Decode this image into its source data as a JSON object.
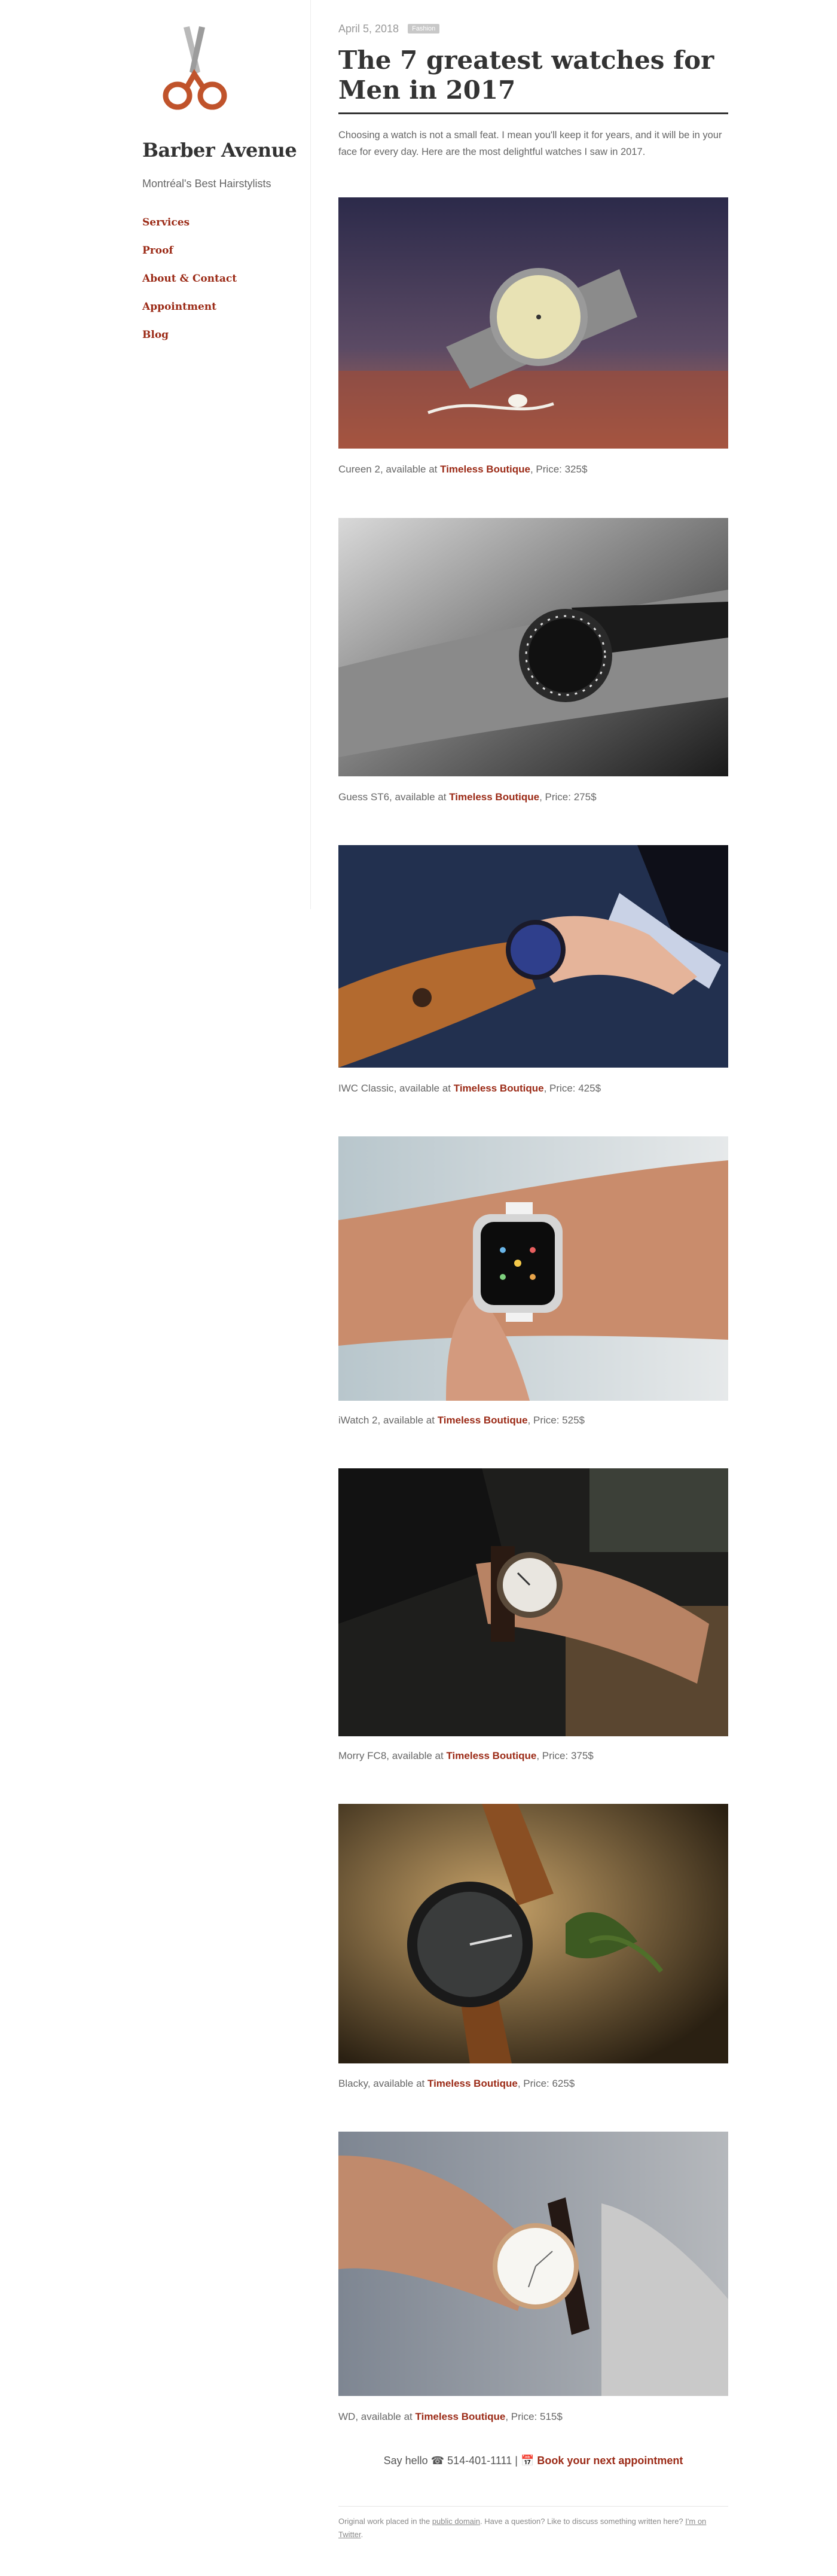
{
  "site": {
    "title": "Barber Avenue",
    "tagline": "Montréal's Best Hairstylists",
    "logo_icon": "scissors-icon",
    "accent": "#9b2a16"
  },
  "nav": [
    {
      "label": "Services"
    },
    {
      "label": "Proof"
    },
    {
      "label": "About & Contact"
    },
    {
      "label": "Appointment"
    },
    {
      "label": "Blog"
    }
  ],
  "post": {
    "date": "April 5, 2018",
    "tag": "Fashion",
    "title": "The 7 greatest watches for Men in 2017",
    "intro": "Choosing a watch is not a small feat. I mean you'll keep it for years, and it will be in your face for every day. Here are the most delightful watches I saw in 2017."
  },
  "items": [
    {
      "name": "Cureen 2",
      "shop": "Timeless Boutique",
      "price": "325$",
      "image": "watch-photo-cureen"
    },
    {
      "name": "Guess ST6",
      "shop": "Timeless Boutique",
      "price": "275$",
      "image": "watch-photo-guess"
    },
    {
      "name": "IWC Classic",
      "shop": "Timeless Boutique",
      "price": "425$",
      "image": "watch-photo-iwc"
    },
    {
      "name": "iWatch 2",
      "shop": "Timeless Boutique",
      "price": "525$",
      "image": "watch-photo-iwatch"
    },
    {
      "name": "Morry FC8",
      "shop": "Timeless Boutique",
      "price": "375$",
      "image": "watch-photo-morry"
    },
    {
      "name": "Blacky",
      "shop": "Timeless Boutique",
      "price": "625$",
      "image": "watch-photo-blacky"
    },
    {
      "name": "WD",
      "shop": "Timeless Boutique",
      "price": "515$",
      "image": "watch-photo-wd"
    }
  ],
  "caption_parts": {
    "available_at": ", available at ",
    "price_prefix": ", Price: "
  },
  "footer": {
    "say_hello": "Say hello",
    "phone_icon": "phone-icon",
    "phone": "514-401-1111",
    "separator": "|",
    "calendar_icon": "calendar-icon",
    "book_label": "Book your next appointment",
    "note_prefix": "Original work placed in the ",
    "public_domain_link": "public domain",
    "note_middle": ". Have a question? Like to discuss something written here? ",
    "twitter_link": "I'm on Twitter",
    "note_suffix": "."
  }
}
